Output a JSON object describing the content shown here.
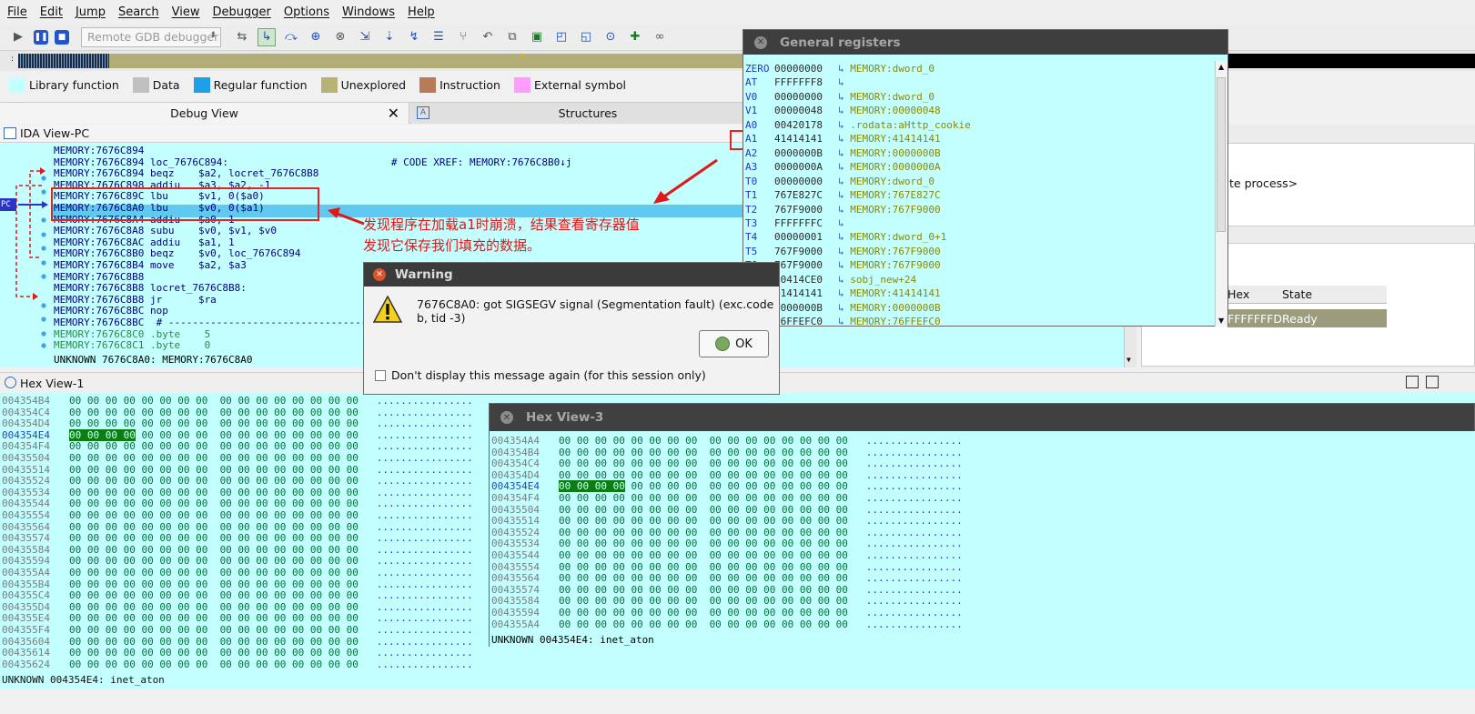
{
  "menu": [
    "File",
    "Edit",
    "Jump",
    "Search",
    "View",
    "Debugger",
    "Options",
    "Windows",
    "Help"
  ],
  "toolbar": {
    "debugger_select": "Remote GDB debugger"
  },
  "legend": [
    {
      "label": "Library function",
      "color": "#c4ffff"
    },
    {
      "label": "Data",
      "color": "#c0c0c0"
    },
    {
      "label": "Regular function",
      "color": "#1f9fe6"
    },
    {
      "label": "Unexplored",
      "color": "#b6b474"
    },
    {
      "label": "Instruction",
      "color": "#b87b5a"
    },
    {
      "label": "External symbol",
      "color": "#ff9cff"
    }
  ],
  "tabs": {
    "debug_view": "Debug View",
    "structures": "Structures"
  },
  "ida_view": {
    "title": "IDA View-PC",
    "pc_label": "PC",
    "lines": [
      "MEMORY:7676C894",
      "MEMORY:7676C894 loc_7676C894:                           # CODE XREF: MEMORY:7676C8B0↓j",
      "MEMORY:7676C894 beqz    $a2, locret_7676C8B8",
      "MEMORY:7676C898 addiu   $a3, $a2, -1",
      "MEMORY:7676C89C lbu     $v1, 0($a0)",
      "MEMORY:7676C8A0 lbu     $v0, 0($a1)",
      "MEMORY:7676C8A4 addiu   $a0, 1",
      "MEMORY:7676C8A8 subu    $v0, $v1, $v0",
      "MEMORY:7676C8AC addiu   $a1, 1",
      "MEMORY:7676C8B0 beqz    $v0, loc_7676C894",
      "MEMORY:7676C8B4 move    $a2, $a3",
      "MEMORY:7676C8B8",
      "MEMORY:7676C8B8 locret_7676C8B8:",
      "MEMORY:7676C8B8 jr      $ra",
      "MEMORY:7676C8BC nop",
      "MEMORY:7676C8BC  # ---------------------------------------------------------------------------",
      "MEMORY:7676C8C0 .byte    5",
      "MEMORY:7676C8C1 .byte    0"
    ],
    "status": "UNKNOWN 7676C8A0: MEMORY:7676C8A0"
  },
  "annotation": {
    "line1": "发现程序在加载a1时崩溃，结果查看寄存器值",
    "line2": "发现它保存我们填充的数据。"
  },
  "registers": {
    "title": "General registers",
    "rows": [
      {
        "name": "ZERO",
        "value": "00000000",
        "ref": "MEMORY:dword_0"
      },
      {
        "name": "AT",
        "value": "FFFFFFF8",
        "ref": ""
      },
      {
        "name": "V0",
        "value": "00000000",
        "ref": "MEMORY:dword_0"
      },
      {
        "name": "V1",
        "value": "00000048",
        "ref": "MEMORY:00000048"
      },
      {
        "name": "A0",
        "value": "00420178",
        "ref": ".rodata:aHttp_cookie"
      },
      {
        "name": "A1",
        "value": "41414141",
        "ref": "MEMORY:41414141"
      },
      {
        "name": "A2",
        "value": "0000000B",
        "ref": "MEMORY:0000000B"
      },
      {
        "name": "A3",
        "value": "0000000A",
        "ref": "MEMORY:0000000A"
      },
      {
        "name": "T0",
        "value": "00000000",
        "ref": "MEMORY:dword_0"
      },
      {
        "name": "T1",
        "value": "767E827C",
        "ref": "MEMORY:767E827C"
      },
      {
        "name": "T2",
        "value": "767F9000",
        "ref": "MEMORY:767F9000"
      },
      {
        "name": "T3",
        "value": "FFFFFFFC",
        "ref": ""
      },
      {
        "name": "T4",
        "value": "00000001",
        "ref": "MEMORY:dword_0+1"
      },
      {
        "name": "T5",
        "value": "767F9000",
        "ref": "MEMORY:767F9000"
      },
      {
        "name": "T6",
        "value": "767F9000",
        "ref": "MEMORY:767F9000"
      },
      {
        "name": "T7",
        "value": "00414CE0",
        "ref": "sobj_new+24"
      },
      {
        "name": "S0",
        "value": "41414141",
        "ref": "MEMORY:41414141"
      },
      {
        "name": "S1",
        "value": "0000000B",
        "ref": "MEMORY:0000000B"
      },
      {
        "name": "S2",
        "value": "76FFEFC0",
        "ref": "MEMORY:76FFEFC0"
      }
    ]
  },
  "right_pane": {
    "process_text": "te process>",
    "col_hex": "Hex",
    "col_state": "State",
    "row_hex": "FFFFFFFD",
    "row_state": "Ready"
  },
  "warning": {
    "title": "Warning",
    "message": "7676C8A0: got SIGSEGV signal (Segmentation fault) (exc.code b, tid -3)",
    "ok": "OK",
    "checkbox": "Don't display this message again (for this session only)"
  },
  "hex1": {
    "title": "Hex View-1",
    "addresses": [
      "004354B4",
      "004354C4",
      "004354D4",
      "004354E4",
      "004354F4",
      "00435504",
      "00435514",
      "00435524",
      "00435534",
      "00435544",
      "00435554",
      "00435564",
      "00435574",
      "00435584",
      "00435594",
      "004355A4",
      "004355B4",
      "004355C4",
      "004355D4",
      "004355E4",
      "004355F4",
      "00435604",
      "00435614",
      "00435624"
    ],
    "current": "004354E4",
    "status": "UNKNOWN 004354E4: inet_aton"
  },
  "hex3": {
    "title": "Hex View-3",
    "addresses": [
      "004354A4",
      "004354B4",
      "004354C4",
      "004354D4",
      "004354E4",
      "004354F4",
      "00435504",
      "00435514",
      "00435524",
      "00435534",
      "00435544",
      "00435554",
      "00435564",
      "00435574",
      "00435584",
      "00435594",
      "004355A4"
    ],
    "current": "004354E4",
    "status": "UNKNOWN 004354E4: inet_aton"
  }
}
